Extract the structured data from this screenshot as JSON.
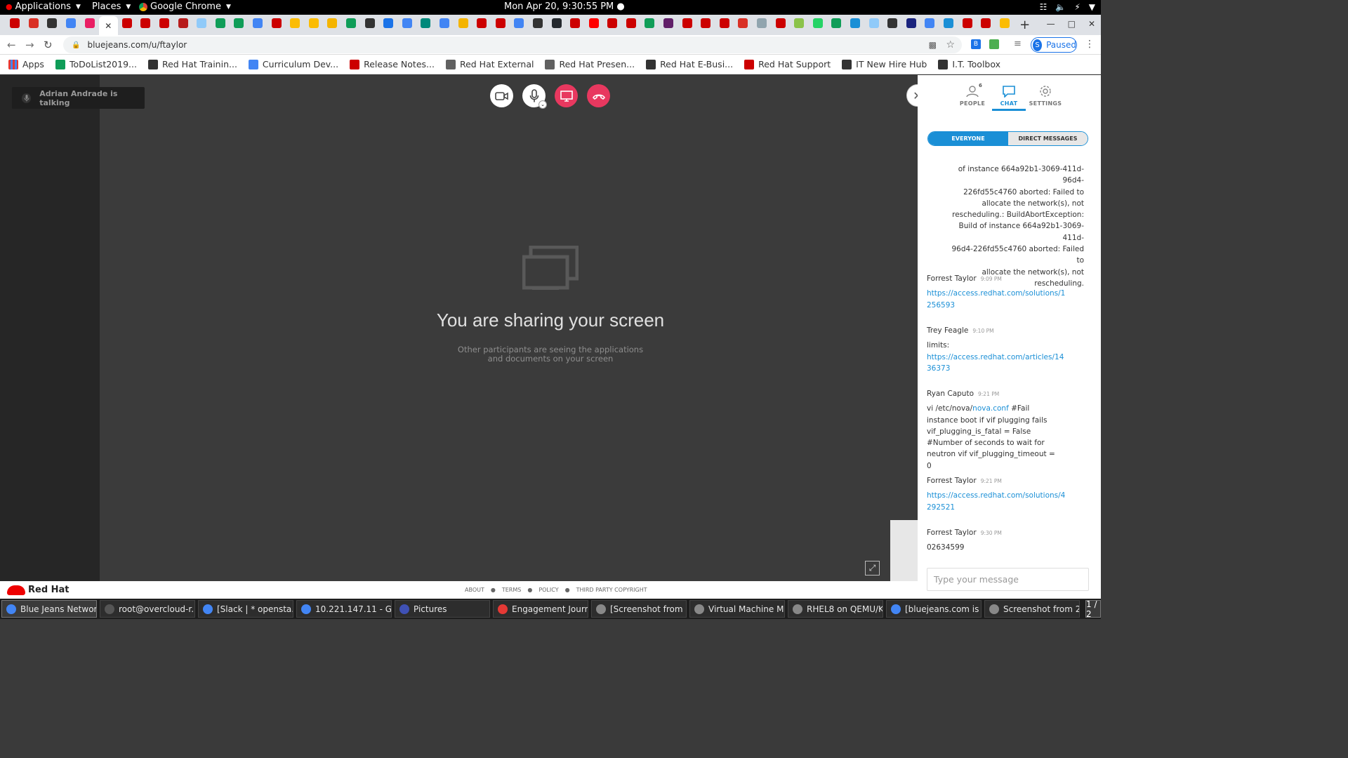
{
  "topbar": {
    "applications": "Applications",
    "places": "Places",
    "chrome": "Google Chrome",
    "clock": "Mon Apr 20,  9:30:55 PM ●"
  },
  "tabs": {
    "favicon_colors": [
      "#cc0000",
      "#d93025",
      "#333333",
      "#4285f4",
      "#e91e63",
      "#ffffff",
      "#cc0000",
      "#cc0000",
      "#cc0000",
      "#b71c1c",
      "#90caf9",
      "#0f9d58",
      "#0f9d58",
      "#4285f4",
      "#cc0000",
      "#fbbc04",
      "#fbbc04",
      "#f4b400",
      "#0f9d58",
      "#333333",
      "#1a73e8",
      "#4285f4",
      "#00897b",
      "#4285f4",
      "#f4b400",
      "#cc0000",
      "#cc0000",
      "#4285f4",
      "#333333",
      "#24292e",
      "#cc0000",
      "#ff0000",
      "#cc0000",
      "#cc0000",
      "#0f9d58",
      "#611f69",
      "#cc0000",
      "#cc0000",
      "#cc0000",
      "#d93025",
      "#90a4ae",
      "#cc0000",
      "#8bc34a",
      "#25d366",
      "#0f9d58",
      "#1a8fd6",
      "#90caf9",
      "#333333",
      "#1a237e",
      "#4285f4",
      "#1a8fd6",
      "#cc0000",
      "#cc0000",
      "#fbbc04"
    ],
    "new_tab": "+",
    "close_active": "✕"
  },
  "address": {
    "url": "bluejeans.com/u/ftaylor",
    "profile_initial": "S",
    "profile_status": "Paused"
  },
  "bookmarks": [
    {
      "label": "Apps",
      "color": "#e53935"
    },
    {
      "label": "ToDoList2019...",
      "color": "#0f9d58"
    },
    {
      "label": "Red Hat Trainin...",
      "color": "#333333"
    },
    {
      "label": "Curriculum Dev...",
      "color": "#4285f4"
    },
    {
      "label": "Release Notes...",
      "color": "#cc0000"
    },
    {
      "label": "Red Hat External",
      "color": "#616161"
    },
    {
      "label": "Red Hat Presen...",
      "color": "#616161"
    },
    {
      "label": "Red Hat E-Busi...",
      "color": "#333333"
    },
    {
      "label": "Red Hat Support",
      "color": "#cc0000"
    },
    {
      "label": "IT New Hire Hub",
      "color": "#333333"
    },
    {
      "label": "I.T. Toolbox",
      "color": "#333333"
    }
  ],
  "meeting": {
    "talking": "Adrian Andrade is talking",
    "share_title": "You are sharing your screen",
    "share_sub_1": "Other participants are seeing the applications",
    "share_sub_2": "and documents on your screen"
  },
  "panel": {
    "people_label": "PEOPLE",
    "people_count": "6",
    "chat_label": "CHAT",
    "settings_label": "SETTINGS",
    "everyone": "EVERYONE",
    "direct": "DIRECT MESSAGES",
    "system_lines": [
      "of instance 664a92b1-3069-411d-96d4-",
      "226fd55c4760 aborted: Failed to",
      "allocate the network(s), not",
      "rescheduling.: BuildAbortException:",
      "Build of instance 664a92b1-3069-411d-",
      "96d4-226fd55c4760 aborted: Failed to",
      "allocate the network(s), not",
      "rescheduling."
    ],
    "messages": [
      {
        "name": "Forrest Taylor",
        "time": "9:09 PM",
        "link": "https://access.redhat.com/solutions/1256593"
      },
      {
        "name": "Trey Feagle",
        "time": "9:10 PM",
        "text": "limits:",
        "link": "https://access.redhat.com/articles/1436373"
      },
      {
        "name": "Ryan Caputo",
        "time": "9:21 PM",
        "pre": "vi /etc/nova/",
        "inline_link": "nova.conf",
        "post": " #Fail instance boot if vif plugging fails vif_plugging_is_fatal = False #Number of seconds to wait for neutron vif vif_plugging_timeout = 0"
      },
      {
        "name": "Forrest Taylor",
        "time": "9:21 PM",
        "link": "https://access.redhat.com/solutions/4292521"
      },
      {
        "name": "Forrest Taylor",
        "time": "9:30 PM",
        "text": "02634599"
      }
    ],
    "input_placeholder": "Type your message"
  },
  "footer": {
    "brand": "Red Hat",
    "about": "ABOUT",
    "terms": "TERMS",
    "policy": "POLICY",
    "third": "THIRD PARTY COPYRIGHT"
  },
  "taskbar": [
    {
      "label": "Blue Jeans Networ...",
      "color": "#4285f4",
      "active": true
    },
    {
      "label": "root@overcloud-r...",
      "color": "#555555"
    },
    {
      "label": "[Slack | * opensta...",
      "color": "#4285f4"
    },
    {
      "label": "10.221.147.11 - G...",
      "color": "#4285f4"
    },
    {
      "label": "Pictures",
      "color": "#3f51b5"
    },
    {
      "label": "Engagement Journ...",
      "color": "#e53935"
    },
    {
      "label": "[Screenshot from ...",
      "color": "#888888"
    },
    {
      "label": "Virtual Machine M...",
      "color": "#888888"
    },
    {
      "label": "RHEL8 on QEMU/K...",
      "color": "#888888"
    },
    {
      "label": "[bluejeans.com is s...",
      "color": "#4285f4"
    },
    {
      "label": "Screenshot from 2...",
      "color": "#888888"
    }
  ],
  "workspace": "1 / 2"
}
